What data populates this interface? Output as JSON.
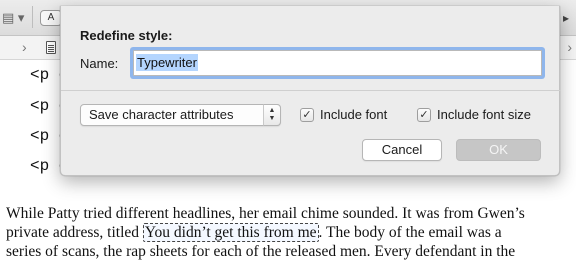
{
  "background": {
    "toolbar": {
      "left_glyph": "▤ ▾",
      "pill_label": "A",
      "right_glyph": "▸"
    },
    "pathbar": {
      "chevron": "›"
    },
    "code_lines": [
      "<p c",
      "<p c",
      "<p c",
      "<p c"
    ],
    "prose": {
      "line1": "While Patty tried different headlines, her email chime sounded. It was from Gwen’s",
      "line2_before": "private address, titled ",
      "line2_selected": "You didn’t get this from me",
      "line2_after": ". The body of the email was a",
      "line3": "series of scans, the rap sheets for each of the released men. Every defendant in the"
    }
  },
  "dialog": {
    "title": "Redefine style:",
    "name_label": "Name:",
    "name_value": "Typewriter",
    "popup_value": "Save character attributes",
    "include_font_label": "Include font",
    "include_font_checked": true,
    "include_font_size_label": "Include font size",
    "include_font_size_checked": true,
    "cancel_label": "Cancel",
    "ok_label": "OK",
    "check_glyph": "✓",
    "popup_arrows": "▲\n▼"
  },
  "colors": {
    "focus_ring": "#8fb6ec",
    "text_selection": "#b4d5fe",
    "ok_disabled": "#c6c6c6"
  }
}
